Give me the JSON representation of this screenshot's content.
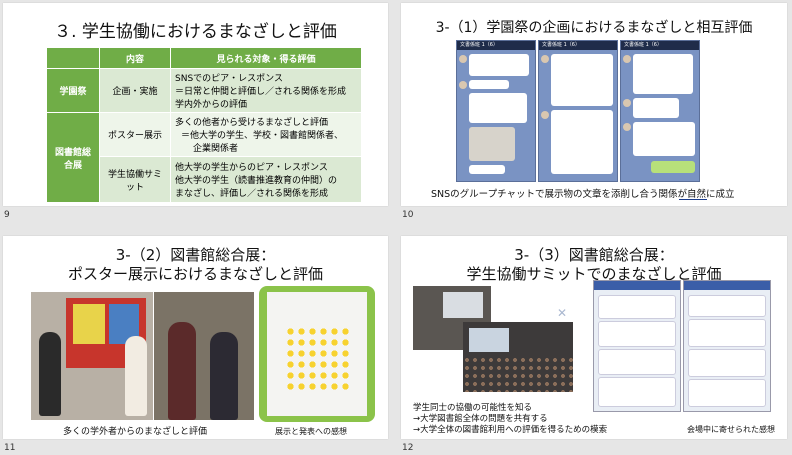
{
  "slides": [
    {
      "number": "9",
      "title": "３. 学生協働におけるまなざしと評価",
      "table": {
        "headers": [
          "内容",
          "見られる対象・得る評価"
        ],
        "rows": [
          {
            "category": "学園祭",
            "content": "企画・実施",
            "lines": [
              "SNSでのピア・レスポンス",
              "＝日常と仲間と評価し／される関係を形成",
              "学内外からの評価"
            ]
          },
          {
            "category": "図書館総合展",
            "content": "ポスター展示",
            "lines": [
              "多くの他者から受けるまなざしと評価",
              "＝他大学の学生、学校・図書館関係者、",
              "企業関係者"
            ]
          },
          {
            "category": "",
            "content": "学生協働サミット",
            "lines": [
              "他大学の学生からのピア・レスポンス",
              "他大学の学生（読書推進教育の仲間）の",
              "まなざし、評価し／される関係を形成"
            ]
          }
        ]
      }
    },
    {
      "number": "10",
      "title": "3-（1）学園祭の企画におけるまなざしと相互評価",
      "chat_header": "文書係班 1（6）",
      "caption": "SNSのグループチャットで展示物の文章を添削し合う関係が自然に成立",
      "caption_underline": "自然に"
    },
    {
      "number": "11",
      "title_line1": "3-（2）図書館総合展：",
      "title_line2": "ポスター展示におけるまなざしと評価",
      "caption_left": "多くの学外者からのまなざしと評価",
      "caption_right": "展示と発表への感想"
    },
    {
      "number": "12",
      "title_line1": "3-（3）図書館総合展：",
      "title_line2": "学生協働サミットでのまなざしと評価",
      "notes": [
        "学生同士の協働の可能性を知る",
        "→大学図書館全体の問題を共有する",
        "→大学全体の図書館利用への評価を得るための模索"
      ],
      "caption_right": "会場中に寄せられた感想"
    }
  ],
  "colors": {
    "green": "#70ad47",
    "light_green": "#dbe9d3",
    "chat_blue": "#7a93c3",
    "background": "#e6e6e6"
  }
}
